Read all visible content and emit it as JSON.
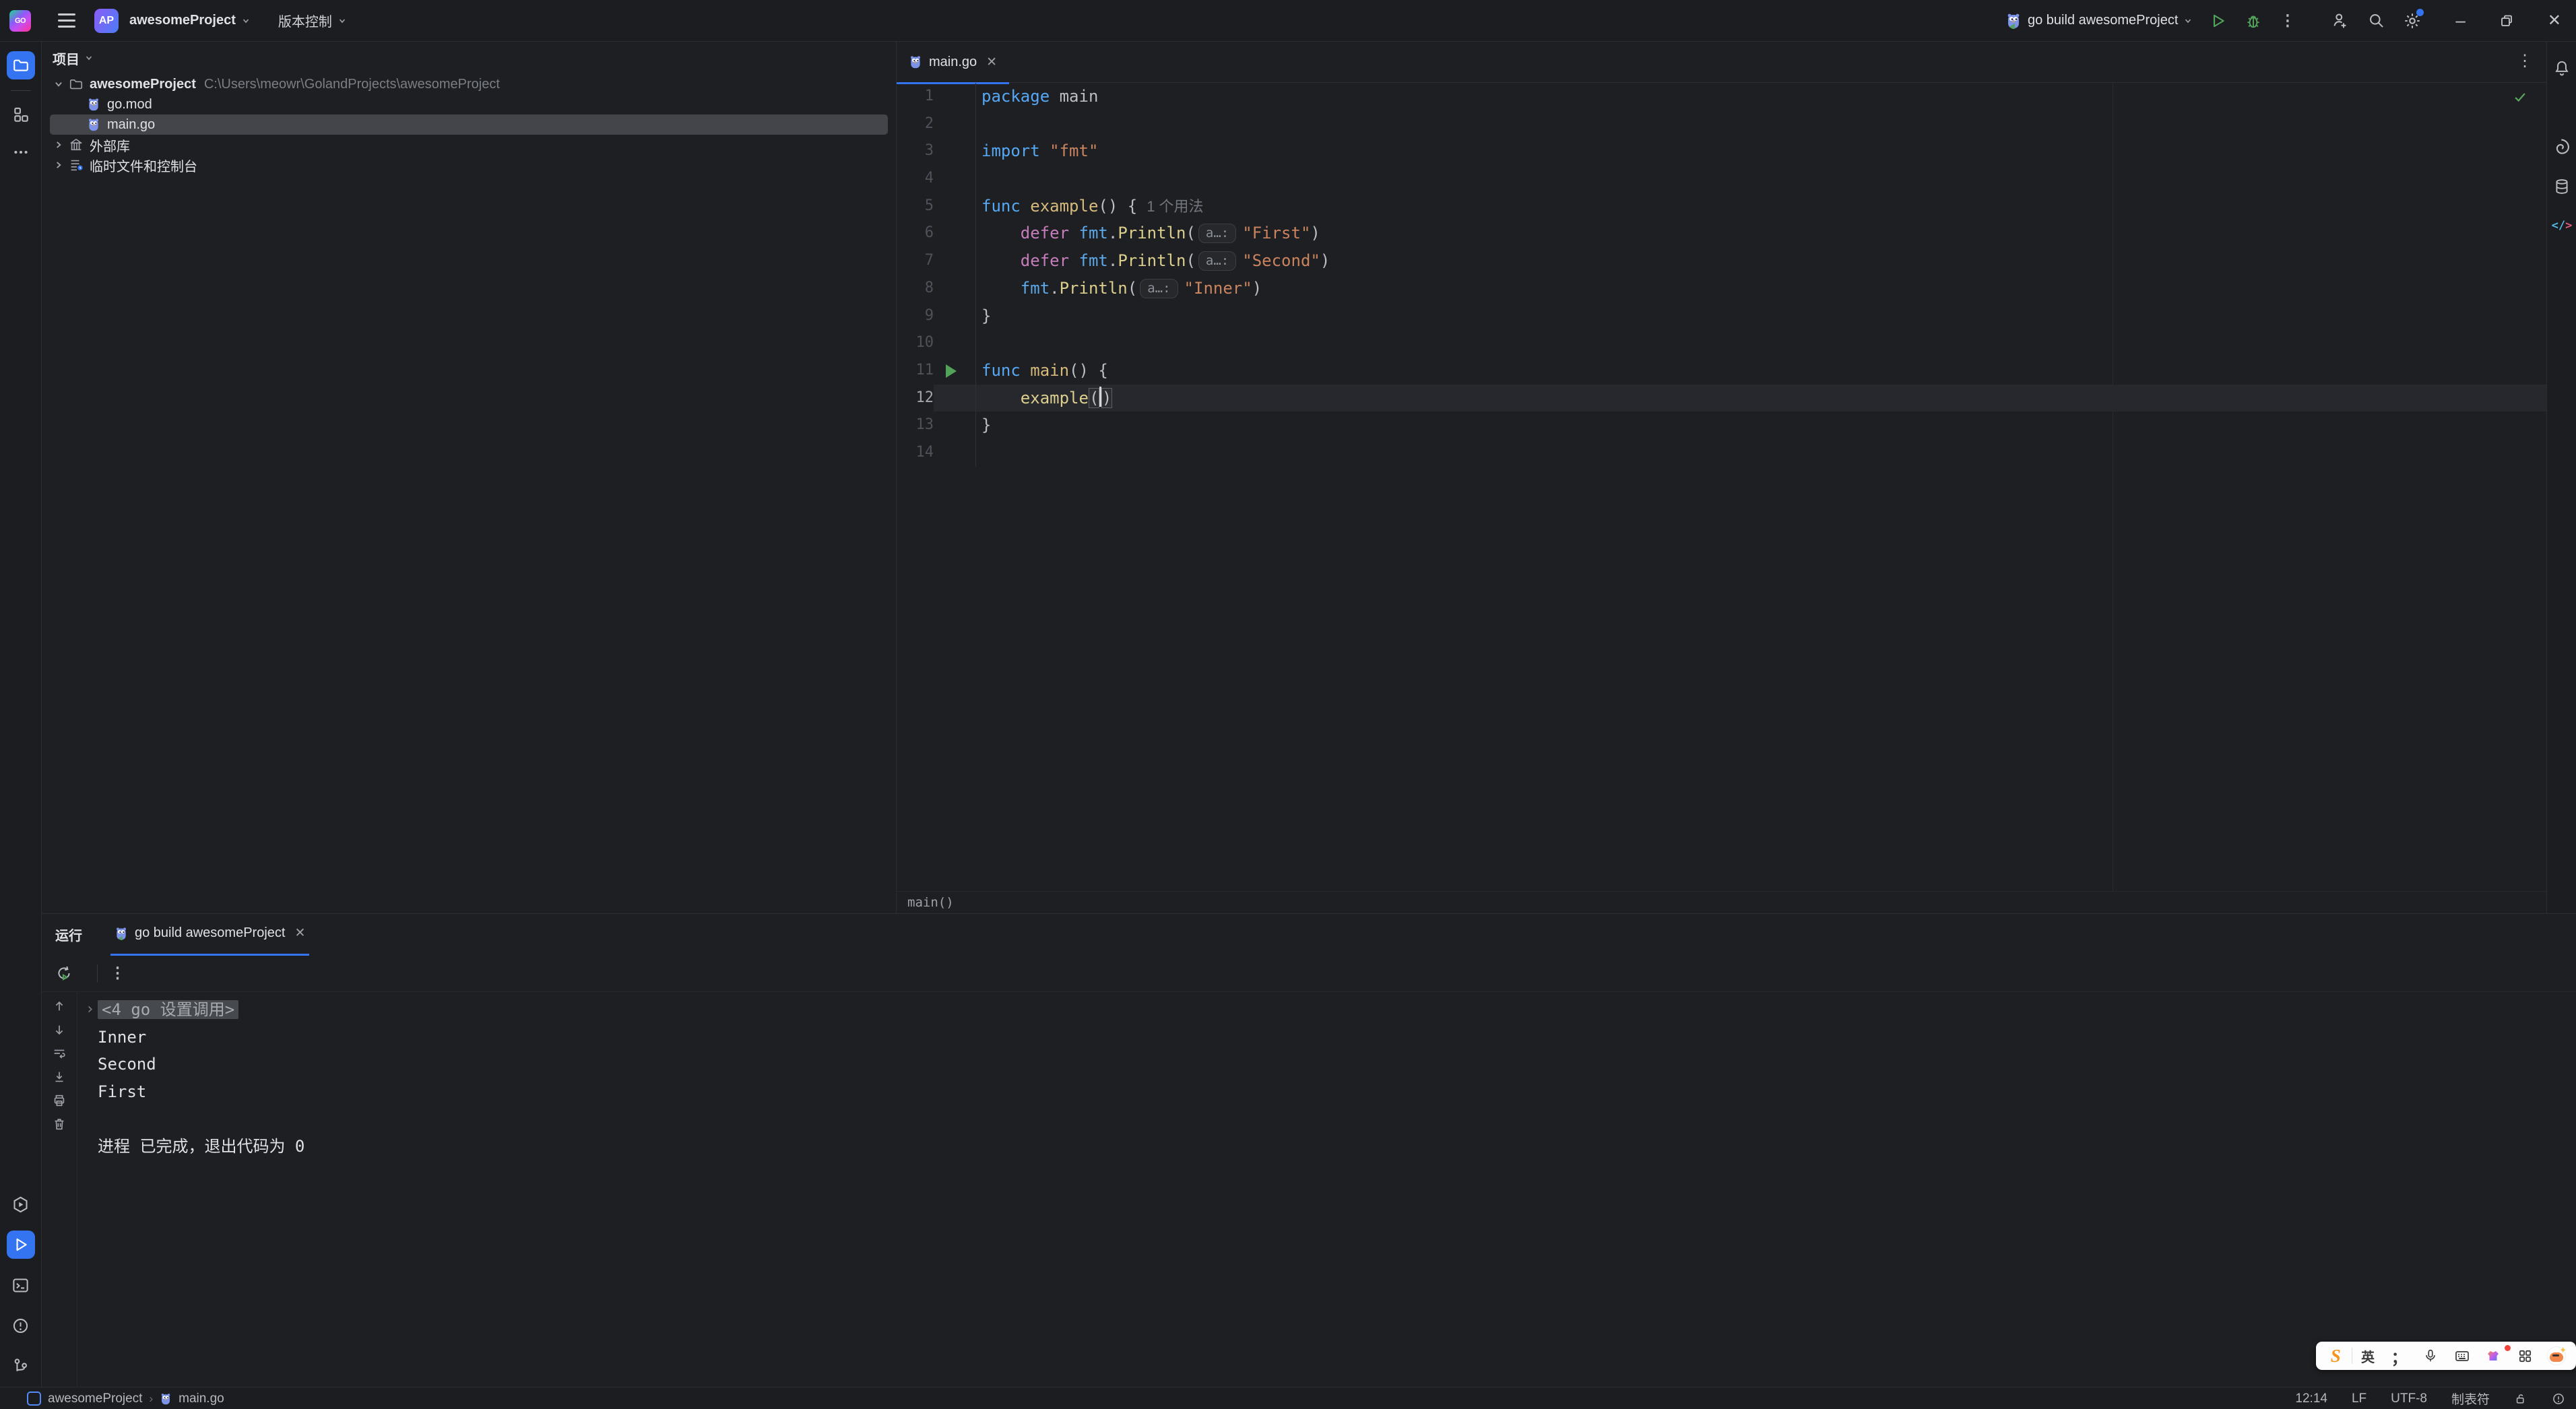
{
  "titlebar": {
    "logo": "GO",
    "project_badge": "AP",
    "project_name": "awesomeProject",
    "vcs": "版本控制",
    "run_config": "go build awesomeProject",
    "minimize": "–",
    "close": "✕"
  },
  "project_panel": {
    "header": "项目",
    "tree": [
      {
        "type": "root",
        "name": "awesomeProject",
        "path": "C:\\Users\\meowr\\GolandProjects\\awesomeProject",
        "expanded": true
      },
      {
        "type": "go",
        "name": "go.mod",
        "indent": 1
      },
      {
        "type": "go",
        "name": "main.go",
        "indent": 1,
        "selected": true
      },
      {
        "type": "lib",
        "name": "外部库",
        "collapsed": true
      },
      {
        "type": "scratch",
        "name": "临时文件和控制台",
        "collapsed": true
      }
    ]
  },
  "editor": {
    "tab": "main.go",
    "breadcrumb": "main()",
    "lines": [
      {
        "num": 1,
        "tokens": [
          [
            "kw",
            "package"
          ],
          [
            "pl",
            " main"
          ]
        ]
      },
      {
        "num": 2,
        "tokens": []
      },
      {
        "num": 3,
        "tokens": [
          [
            "kw",
            "import"
          ],
          [
            "pl",
            " "
          ],
          [
            "str",
            "\"fmt\""
          ]
        ]
      },
      {
        "num": 4,
        "tokens": []
      },
      {
        "num": 5,
        "tokens": [
          [
            "kw",
            "func"
          ],
          [
            "pl",
            " "
          ],
          [
            "fn",
            "example"
          ],
          [
            "pl",
            "() {"
          ],
          [
            "hint",
            "1 个用法"
          ]
        ]
      },
      {
        "num": 6,
        "tokens": [
          [
            "pl",
            "    "
          ],
          [
            "defer",
            "defer"
          ],
          [
            "pl",
            " "
          ],
          [
            "pkg",
            "fmt"
          ],
          [
            "pl",
            "."
          ],
          [
            "call",
            "Println"
          ],
          [
            "pl",
            "("
          ],
          [
            "chip",
            "a…:"
          ],
          [
            "str",
            "\"First\""
          ],
          [
            "pl",
            ")"
          ]
        ]
      },
      {
        "num": 7,
        "tokens": [
          [
            "pl",
            "    "
          ],
          [
            "defer",
            "defer"
          ],
          [
            "pl",
            " "
          ],
          [
            "pkg",
            "fmt"
          ],
          [
            "pl",
            "."
          ],
          [
            "call",
            "Println"
          ],
          [
            "pl",
            "("
          ],
          [
            "chip",
            "a…:"
          ],
          [
            "str",
            "\"Second\""
          ],
          [
            "pl",
            ")"
          ]
        ]
      },
      {
        "num": 8,
        "tokens": [
          [
            "pl",
            "    "
          ],
          [
            "pkg",
            "fmt"
          ],
          [
            "pl",
            "."
          ],
          [
            "call",
            "Println"
          ],
          [
            "pl",
            "("
          ],
          [
            "chip",
            "a…:"
          ],
          [
            "str",
            "\"Inner\""
          ],
          [
            "pl",
            ")"
          ]
        ]
      },
      {
        "num": 9,
        "tokens": [
          [
            "pl",
            "}"
          ]
        ]
      },
      {
        "num": 10,
        "tokens": []
      },
      {
        "num": 11,
        "gutter": "run",
        "tokens": [
          [
            "kw",
            "func"
          ],
          [
            "pl",
            " "
          ],
          [
            "fn",
            "main"
          ],
          [
            "pl",
            "() {"
          ]
        ]
      },
      {
        "num": 12,
        "current": true,
        "bulb": true,
        "tokens": [
          [
            "pl",
            "    "
          ],
          [
            "call",
            "example"
          ],
          [
            "brace",
            "("
          ],
          [
            "caret",
            ""
          ],
          [
            "brace",
            ")"
          ]
        ]
      },
      {
        "num": 13,
        "tokens": [
          [
            "pl",
            "}"
          ]
        ]
      },
      {
        "num": 14,
        "tokens": []
      }
    ]
  },
  "console": {
    "tool_label": "运行",
    "tab": "go build awesomeProject",
    "lines": [
      {
        "fold": true,
        "text": "<4 go 设置调用>"
      },
      {
        "text": "Inner"
      },
      {
        "text": "Second"
      },
      {
        "text": "First"
      },
      {
        "text": ""
      },
      {
        "text": "进程 已完成，退出代码为 0"
      }
    ]
  },
  "statusbar": {
    "crumbs": [
      "awesomeProject",
      "main.go"
    ],
    "right": [
      "12:14",
      "LF",
      "UTF-8",
      "制表符"
    ]
  },
  "ime": {
    "lang": "英",
    "punct": "；"
  },
  "colors": {
    "accent": "#3574F0",
    "run_green": "#52A35A",
    "ok_green": "#5CA55F"
  }
}
